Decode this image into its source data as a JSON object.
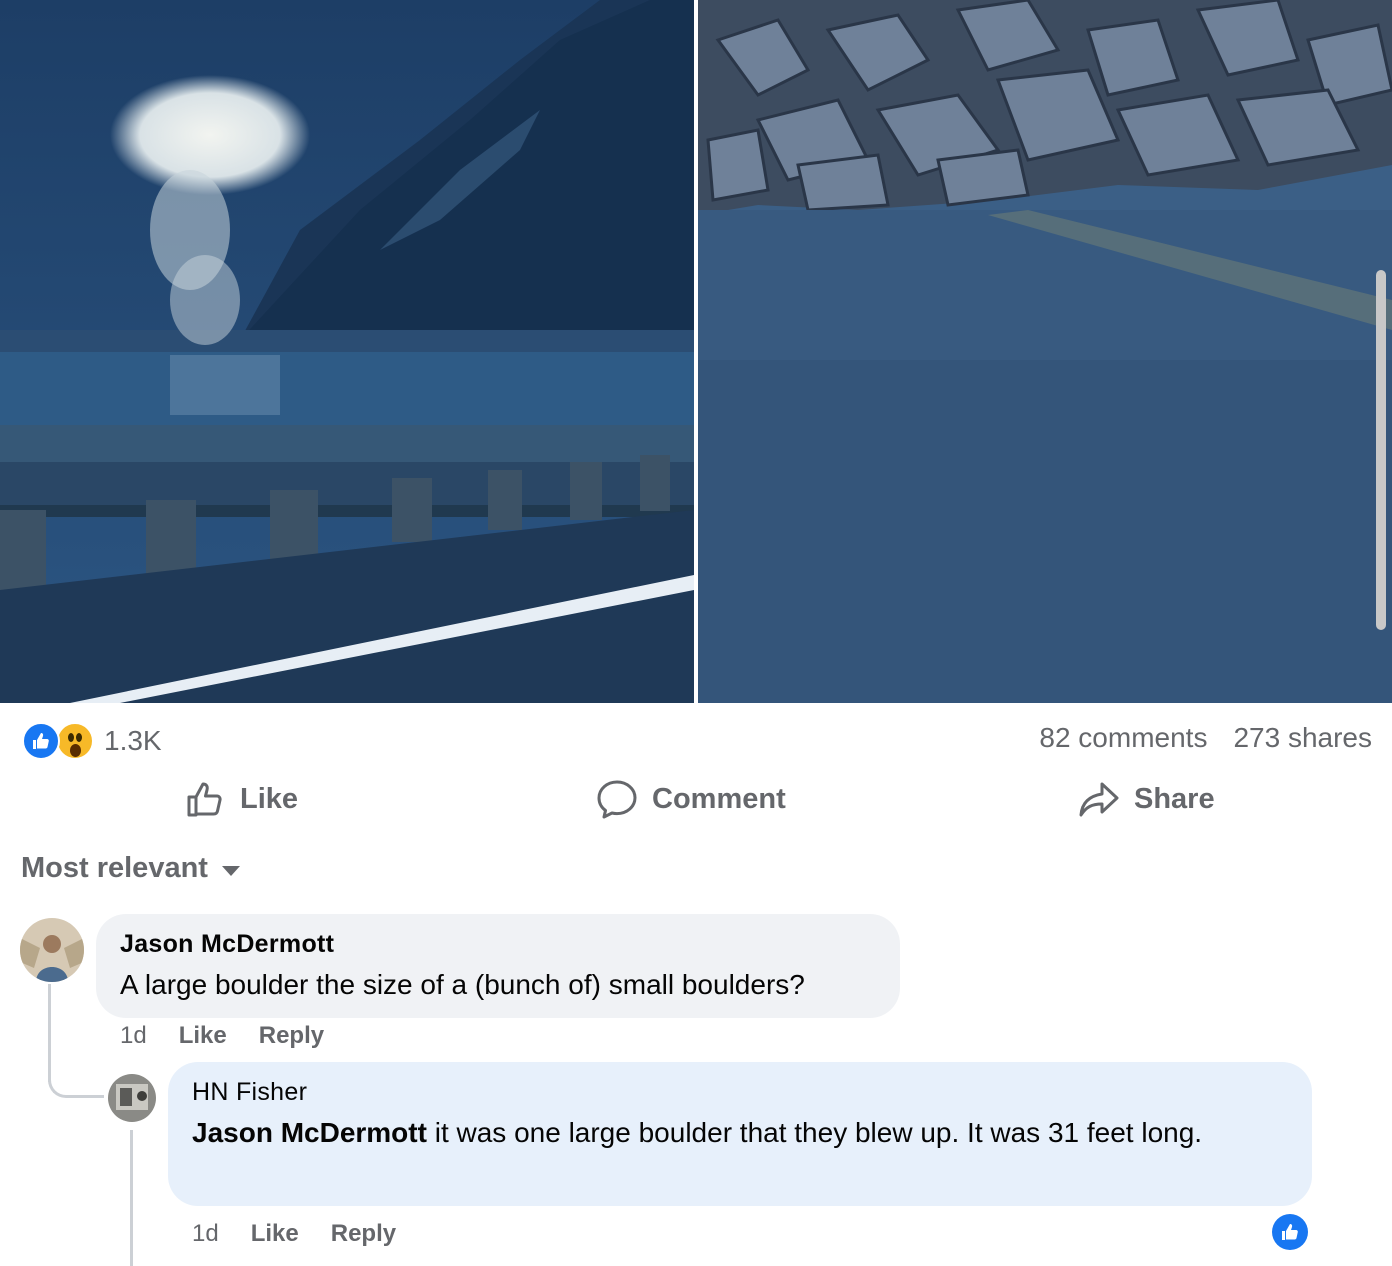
{
  "post": {
    "reaction_count": "1.3K",
    "comments_count": "82 comments",
    "shares_count": "273 shares",
    "reaction_types": [
      "like-icon",
      "wow-icon"
    ]
  },
  "actions": {
    "like_label": "Like",
    "comment_label": "Comment",
    "share_label": "Share"
  },
  "filter": {
    "label": "Most relevant"
  },
  "comments": [
    {
      "author": "Jason McDermott",
      "text": "A large boulder the size of a (bunch of) small boulders?",
      "time": "1d",
      "like_label": "Like",
      "reply_label": "Reply"
    },
    {
      "author": "HN Fisher",
      "mention": "Jason McDermott",
      "text": " it was one large boulder that they blew up. It was 31 feet long.",
      "time": "1d",
      "like_label": "Like",
      "reply_label": "Reply",
      "reaction": "like-icon"
    }
  ],
  "colors": {
    "brand_blue": "#1877f2",
    "muted_text": "#65676b",
    "bubble_grey": "#f0f2f5",
    "bubble_blue": "#e7f0fb"
  }
}
